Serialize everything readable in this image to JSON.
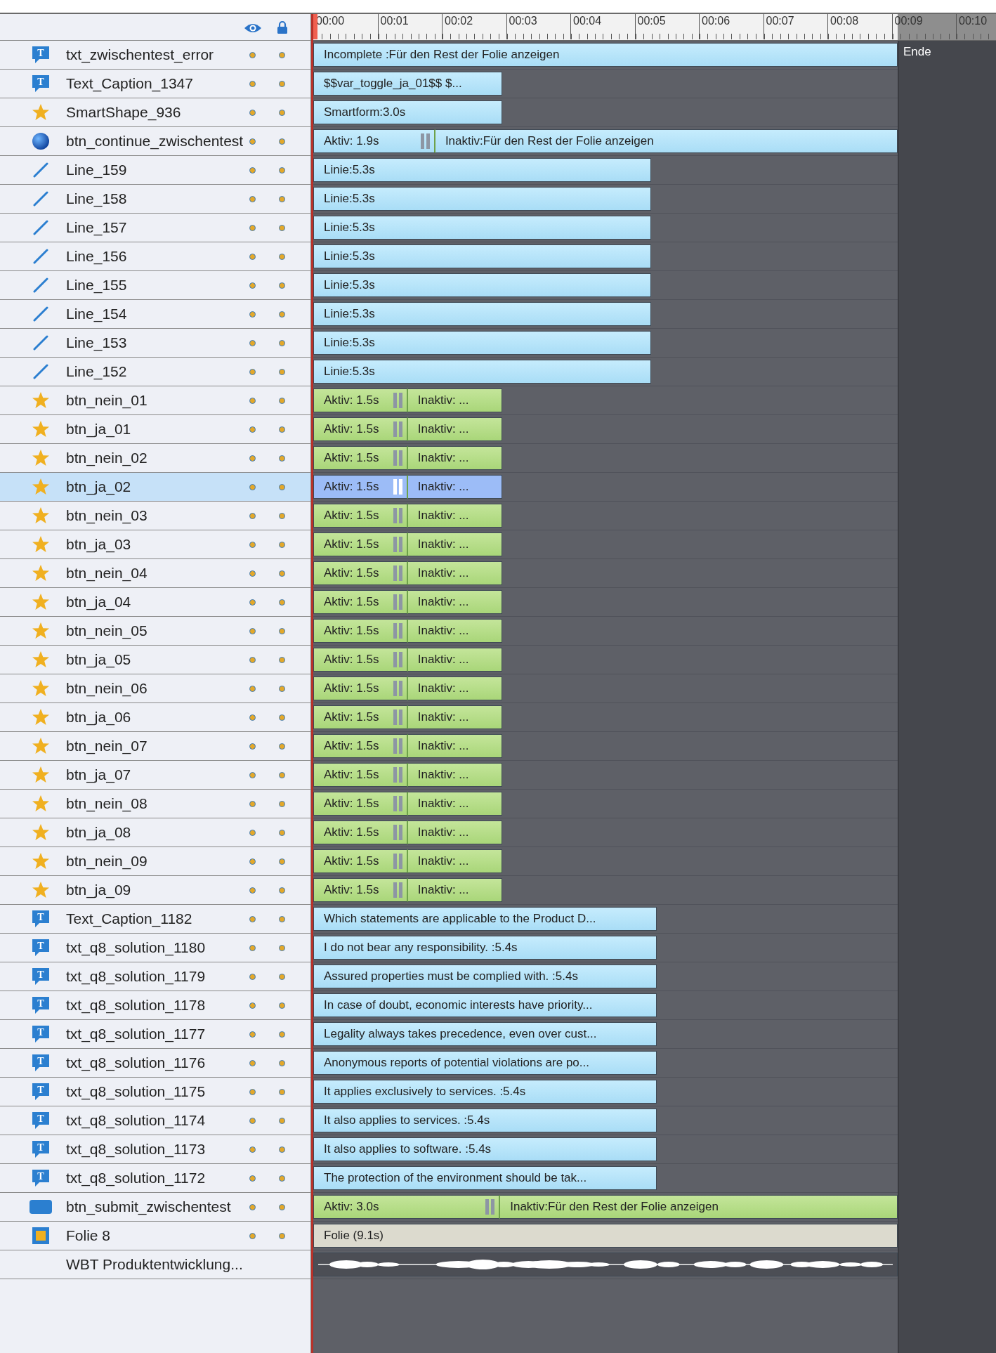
{
  "ruler": {
    "labels": [
      "00:00",
      "00:01",
      "00:02",
      "00:03",
      "00:04",
      "00:05",
      "00:06",
      "00:07",
      "00:08",
      "00:09",
      "00:10"
    ]
  },
  "end_label": "Ende",
  "rows": [
    {
      "name": "txt_zwischentest_error",
      "kind": "caption",
      "icon_label": "T",
      "selected": false,
      "bar": {
        "kind": "object",
        "segments": [
          {
            "kind": "plain",
            "label": "Incomplete :Für den Rest der Folie anzeigen",
            "level": 1.0
          }
        ]
      }
    },
    {
      "name": "Text_Caption_1347",
      "kind": "caption",
      "icon_label": "T",
      "selected": false,
      "bar": {
        "kind": "object",
        "segments": [
          {
            "kind": "plain",
            "label": "$$var_toggle_ja_01$$ $...",
            "level": 0.323
          }
        ]
      }
    },
    {
      "name": "SmartShape_936",
      "kind": "star",
      "selected": false,
      "bar": {
        "kind": "object",
        "segments": [
          {
            "kind": "plain",
            "label": "Smartform:3.0s",
            "level": 0.323
          }
        ]
      }
    },
    {
      "name": "btn_continue_zwischentest",
      "kind": "sphere",
      "selected": false,
      "bar": {
        "kind": "object",
        "segments": [
          {
            "kind": "active",
            "label": "Aktiv: 1.9s",
            "level": 0.209
          },
          {
            "kind": "inactive",
            "label": "Inaktiv:Für den Rest der Folie anzeigen",
            "level": 0.791
          }
        ]
      }
    },
    {
      "name": "Line_159",
      "kind": "line",
      "selected": false,
      "bar": {
        "kind": "object",
        "segments": [
          {
            "kind": "plain",
            "label": "Linie:5.3s",
            "level": 0.578
          }
        ]
      }
    },
    {
      "name": "Line_158",
      "kind": "line",
      "selected": false,
      "bar": {
        "kind": "object",
        "segments": [
          {
            "kind": "plain",
            "label": "Linie:5.3s",
            "level": 0.578
          }
        ]
      }
    },
    {
      "name": "Line_157",
      "kind": "line",
      "selected": false,
      "bar": {
        "kind": "object",
        "segments": [
          {
            "kind": "plain",
            "label": "Linie:5.3s",
            "level": 0.578
          }
        ]
      }
    },
    {
      "name": "Line_156",
      "kind": "line",
      "selected": false,
      "bar": {
        "kind": "object",
        "segments": [
          {
            "kind": "plain",
            "label": "Linie:5.3s",
            "level": 0.578
          }
        ]
      }
    },
    {
      "name": "Line_155",
      "kind": "line",
      "selected": false,
      "bar": {
        "kind": "object",
        "segments": [
          {
            "kind": "plain",
            "label": "Linie:5.3s",
            "level": 0.578
          }
        ]
      }
    },
    {
      "name": "Line_154",
      "kind": "line",
      "selected": false,
      "bar": {
        "kind": "object",
        "segments": [
          {
            "kind": "plain",
            "label": "Linie:5.3s",
            "level": 0.578
          }
        ]
      }
    },
    {
      "name": "Line_153",
      "kind": "line",
      "selected": false,
      "bar": {
        "kind": "object",
        "segments": [
          {
            "kind": "plain",
            "label": "Linie:5.3s",
            "level": 0.578
          }
        ]
      }
    },
    {
      "name": "Line_152",
      "kind": "line",
      "selected": false,
      "bar": {
        "kind": "object",
        "segments": [
          {
            "kind": "plain",
            "label": "Linie:5.3s",
            "level": 0.578
          }
        ]
      }
    },
    {
      "name": "btn_nein_01",
      "kind": "star",
      "selected": false,
      "bar": {
        "kind": "interactive",
        "segments": [
          {
            "kind": "active",
            "label": "Aktiv: 1.5s",
            "level": 0.162
          },
          {
            "kind": "inactive",
            "label": "Inaktiv: ...",
            "level": 0.161
          }
        ]
      }
    },
    {
      "name": "btn_ja_01",
      "kind": "star",
      "selected": false,
      "bar": {
        "kind": "interactive",
        "segments": [
          {
            "kind": "active",
            "label": "Aktiv: 1.5s",
            "level": 0.162
          },
          {
            "kind": "inactive",
            "label": "Inaktiv: ...",
            "level": 0.161
          }
        ]
      }
    },
    {
      "name": "btn_nein_02",
      "kind": "star",
      "selected": false,
      "bar": {
        "kind": "interactive",
        "segments": [
          {
            "kind": "active",
            "label": "Aktiv: 1.5s",
            "level": 0.162
          },
          {
            "kind": "inactive",
            "label": "Inaktiv: ...",
            "level": 0.161
          }
        ]
      }
    },
    {
      "name": "btn_ja_02",
      "kind": "star",
      "selected": true,
      "bar": {
        "kind": "interactive",
        "segments": [
          {
            "kind": "active",
            "label": "Aktiv: 1.5s",
            "level": 0.162
          },
          {
            "kind": "inactive",
            "label": "Inaktiv: ...",
            "level": 0.161
          }
        ]
      }
    },
    {
      "name": "btn_nein_03",
      "kind": "star",
      "selected": false,
      "bar": {
        "kind": "interactive",
        "segments": [
          {
            "kind": "active",
            "label": "Aktiv: 1.5s",
            "level": 0.162
          },
          {
            "kind": "inactive",
            "label": "Inaktiv: ...",
            "level": 0.161
          }
        ]
      }
    },
    {
      "name": "btn_ja_03",
      "kind": "star",
      "selected": false,
      "bar": {
        "kind": "interactive",
        "segments": [
          {
            "kind": "active",
            "label": "Aktiv: 1.5s",
            "level": 0.162
          },
          {
            "kind": "inactive",
            "label": "Inaktiv: ...",
            "level": 0.161
          }
        ]
      }
    },
    {
      "name": "btn_nein_04",
      "kind": "star",
      "selected": false,
      "bar": {
        "kind": "interactive",
        "segments": [
          {
            "kind": "active",
            "label": "Aktiv: 1.5s",
            "level": 0.162
          },
          {
            "kind": "inactive",
            "label": "Inaktiv: ...",
            "level": 0.161
          }
        ]
      }
    },
    {
      "name": "btn_ja_04",
      "kind": "star",
      "selected": false,
      "bar": {
        "kind": "interactive",
        "segments": [
          {
            "kind": "active",
            "label": "Aktiv: 1.5s",
            "level": 0.162
          },
          {
            "kind": "inactive",
            "label": "Inaktiv: ...",
            "level": 0.161
          }
        ]
      }
    },
    {
      "name": "btn_nein_05",
      "kind": "star",
      "selected": false,
      "bar": {
        "kind": "interactive",
        "segments": [
          {
            "kind": "active",
            "label": "Aktiv: 1.5s",
            "level": 0.162
          },
          {
            "kind": "inactive",
            "label": "Inaktiv: ...",
            "level": 0.161
          }
        ]
      }
    },
    {
      "name": "btn_ja_05",
      "kind": "star",
      "selected": false,
      "bar": {
        "kind": "interactive",
        "segments": [
          {
            "kind": "active",
            "label": "Aktiv: 1.5s",
            "level": 0.162
          },
          {
            "kind": "inactive",
            "label": "Inaktiv: ...",
            "level": 0.161
          }
        ]
      }
    },
    {
      "name": "btn_nein_06",
      "kind": "star",
      "selected": false,
      "bar": {
        "kind": "interactive",
        "segments": [
          {
            "kind": "active",
            "label": "Aktiv: 1.5s",
            "level": 0.162
          },
          {
            "kind": "inactive",
            "label": "Inaktiv: ...",
            "level": 0.161
          }
        ]
      }
    },
    {
      "name": "btn_ja_06",
      "kind": "star",
      "selected": false,
      "bar": {
        "kind": "interactive",
        "segments": [
          {
            "kind": "active",
            "label": "Aktiv: 1.5s",
            "level": 0.162
          },
          {
            "kind": "inactive",
            "label": "Inaktiv: ...",
            "level": 0.161
          }
        ]
      }
    },
    {
      "name": "btn_nein_07",
      "kind": "star",
      "selected": false,
      "bar": {
        "kind": "interactive",
        "segments": [
          {
            "kind": "active",
            "label": "Aktiv: 1.5s",
            "level": 0.162
          },
          {
            "kind": "inactive",
            "label": "Inaktiv: ...",
            "level": 0.161
          }
        ]
      }
    },
    {
      "name": "btn_ja_07",
      "kind": "star",
      "selected": false,
      "bar": {
        "kind": "interactive",
        "segments": [
          {
            "kind": "active",
            "label": "Aktiv: 1.5s",
            "level": 0.162
          },
          {
            "kind": "inactive",
            "label": "Inaktiv: ...",
            "level": 0.161
          }
        ]
      }
    },
    {
      "name": "btn_nein_08",
      "kind": "star",
      "selected": false,
      "bar": {
        "kind": "interactive",
        "segments": [
          {
            "kind": "active",
            "label": "Aktiv: 1.5s",
            "level": 0.162
          },
          {
            "kind": "inactive",
            "label": "Inaktiv: ...",
            "level": 0.161
          }
        ]
      }
    },
    {
      "name": "btn_ja_08",
      "kind": "star",
      "selected": false,
      "bar": {
        "kind": "interactive",
        "segments": [
          {
            "kind": "active",
            "label": "Aktiv: 1.5s",
            "level": 0.162
          },
          {
            "kind": "inactive",
            "label": "Inaktiv: ...",
            "level": 0.161
          }
        ]
      }
    },
    {
      "name": "btn_nein_09",
      "kind": "star",
      "selected": false,
      "bar": {
        "kind": "interactive",
        "segments": [
          {
            "kind": "active",
            "label": "Aktiv: 1.5s",
            "level": 0.162
          },
          {
            "kind": "inactive",
            "label": "Inaktiv: ...",
            "level": 0.161
          }
        ]
      }
    },
    {
      "name": "btn_ja_09",
      "kind": "star",
      "selected": false,
      "bar": {
        "kind": "interactive",
        "segments": [
          {
            "kind": "active",
            "label": "Aktiv: 1.5s",
            "level": 0.162
          },
          {
            "kind": "inactive",
            "label": "Inaktiv: ...",
            "level": 0.161
          }
        ]
      }
    },
    {
      "name": "Text_Caption_1182",
      "kind": "caption",
      "icon_label": "T",
      "selected": false,
      "bar": {
        "kind": "object",
        "segments": [
          {
            "kind": "plain",
            "label": "Which statements are applicable to the Product D...",
            "level": 0.588
          }
        ]
      }
    },
    {
      "name": "txt_q8_solution_1180",
      "kind": "caption",
      "icon_label": "T",
      "selected": false,
      "bar": {
        "kind": "object",
        "segments": [
          {
            "kind": "plain",
            "label": "I do not bear any responsibility. :5.4s",
            "level": 0.588
          }
        ]
      }
    },
    {
      "name": "txt_q8_solution_1179",
      "kind": "caption",
      "icon_label": "T",
      "selected": false,
      "bar": {
        "kind": "object",
        "segments": [
          {
            "kind": "plain",
            "label": "Assured properties must be complied with. :5.4s",
            "level": 0.588
          }
        ]
      }
    },
    {
      "name": "txt_q8_solution_1178",
      "kind": "caption",
      "icon_label": "T",
      "selected": false,
      "bar": {
        "kind": "object",
        "segments": [
          {
            "kind": "plain",
            "label": "In case of doubt, economic interests have priority...",
            "level": 0.588
          }
        ]
      }
    },
    {
      "name": "txt_q8_solution_1177",
      "kind": "caption",
      "icon_label": "T",
      "selected": false,
      "bar": {
        "kind": "object",
        "segments": [
          {
            "kind": "plain",
            "label": "Legality always takes precedence, even over cust...",
            "level": 0.588
          }
        ]
      }
    },
    {
      "name": "txt_q8_solution_1176",
      "kind": "caption",
      "icon_label": "T",
      "selected": false,
      "bar": {
        "kind": "object",
        "segments": [
          {
            "kind": "plain",
            "label": "Anonymous reports of potential violations are po...",
            "level": 0.588
          }
        ]
      }
    },
    {
      "name": "txt_q8_solution_1175",
      "kind": "caption",
      "icon_label": "T",
      "selected": false,
      "bar": {
        "kind": "object",
        "segments": [
          {
            "kind": "plain",
            "label": "It applies exclusively to services. :5.4s",
            "level": 0.588
          }
        ]
      }
    },
    {
      "name": "txt_q8_solution_1174",
      "kind": "caption",
      "icon_label": "T",
      "selected": false,
      "bar": {
        "kind": "object",
        "segments": [
          {
            "kind": "plain",
            "label": "It also applies to services.  :5.4s",
            "level": 0.588
          }
        ]
      }
    },
    {
      "name": "txt_q8_solution_1173",
      "kind": "caption",
      "icon_label": "T",
      "selected": false,
      "bar": {
        "kind": "object",
        "segments": [
          {
            "kind": "plain",
            "label": "It also applies to software.  :5.4s",
            "level": 0.588
          }
        ]
      }
    },
    {
      "name": "txt_q8_solution_1172",
      "kind": "caption",
      "icon_label": "T",
      "selected": false,
      "bar": {
        "kind": "object",
        "segments": [
          {
            "kind": "plain",
            "label": "The protection of the environment should be tak...",
            "level": 0.588
          }
        ]
      }
    },
    {
      "name": "btn_submit_zwischentest",
      "kind": "rect",
      "selected": false,
      "bar": {
        "kind": "interactive",
        "segments": [
          {
            "kind": "active",
            "label": "Aktiv: 3.0s",
            "level": 0.32
          },
          {
            "kind": "inactive",
            "label": "Inaktiv:Für den Rest der Folie anzeigen",
            "level": 0.68
          }
        ]
      }
    },
    {
      "name": "Folie 8",
      "kind": "slide",
      "selected": false,
      "bar": {
        "kind": "slide",
        "segments": [
          {
            "kind": "plain",
            "label": "Folie (9.1s)",
            "level": 1.0
          }
        ]
      }
    },
    {
      "name": "WBT Produktentwicklung...",
      "kind": "audio",
      "selected": false,
      "bar": {
        "kind": "audio",
        "segments": [
          {
            "kind": "audio",
            "level": 1.0
          }
        ]
      }
    }
  ]
}
